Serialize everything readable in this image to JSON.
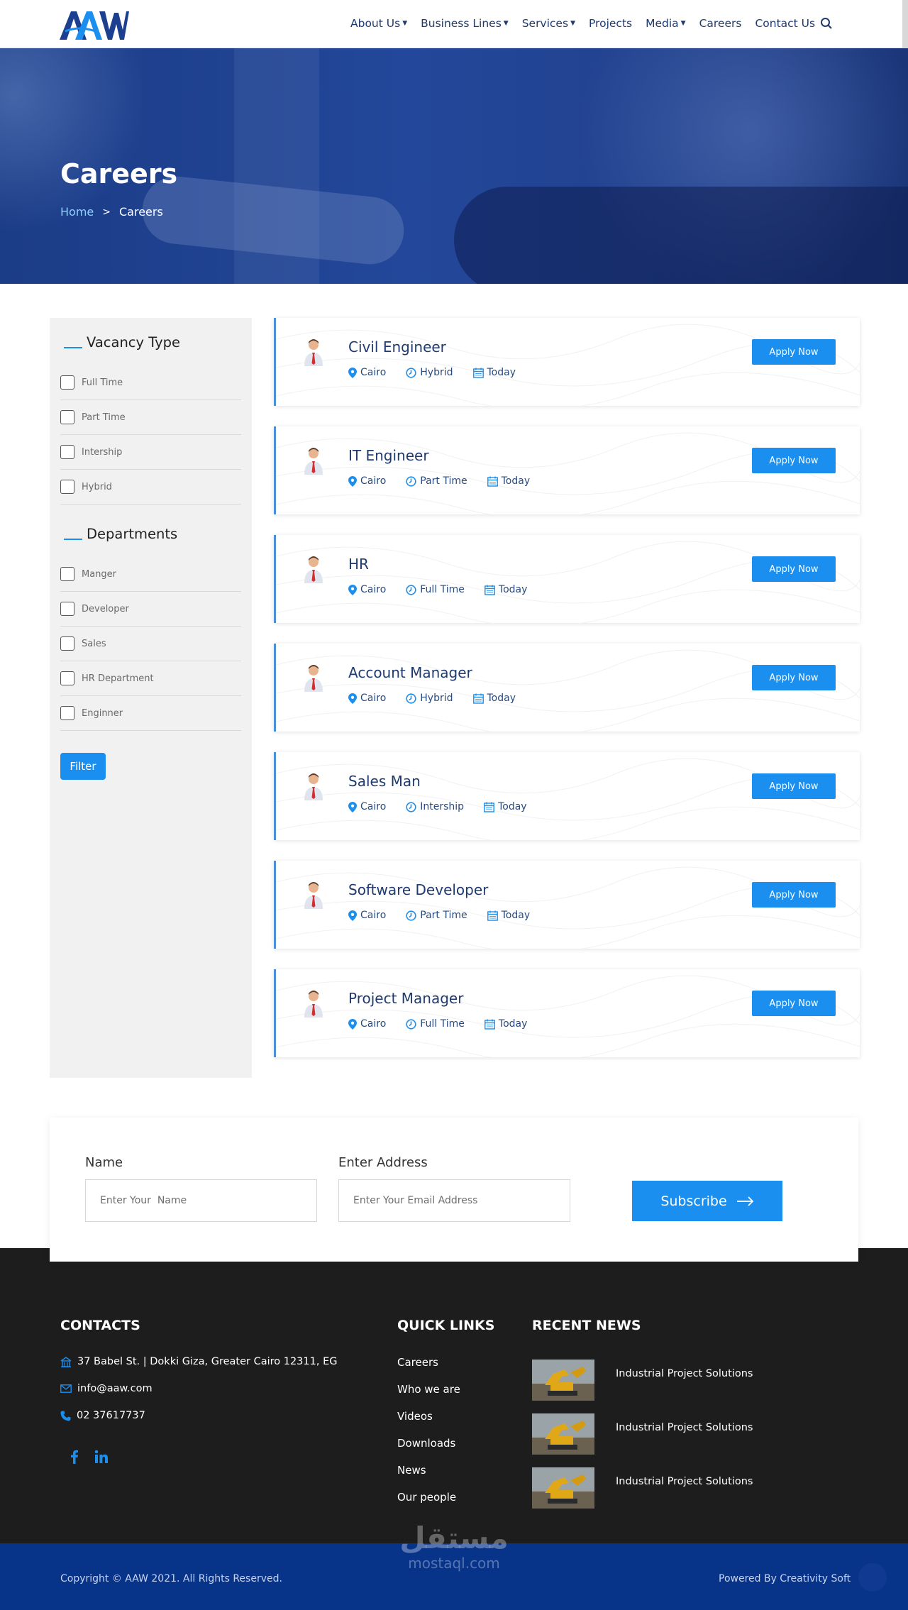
{
  "header": {
    "logo_text": "AAW",
    "nav": [
      {
        "label": "About Us",
        "dropdown": true
      },
      {
        "label": "Business Lines",
        "dropdown": true
      },
      {
        "label": "Services",
        "dropdown": true
      },
      {
        "label": "Projects",
        "dropdown": false
      },
      {
        "label": "Media",
        "dropdown": true
      },
      {
        "label": "Careers",
        "dropdown": false
      },
      {
        "label": "Contact Us",
        "dropdown": false
      }
    ],
    "search_icon": "search-icon"
  },
  "hero": {
    "title": "Careers",
    "breadcrumb": {
      "home": "Home",
      "separator": ">",
      "current": "Careers"
    }
  },
  "sidebar": {
    "vacancy_heading": "Vacancy Type",
    "vacancy_options": [
      "Full Time",
      "Part Time",
      "Intership",
      "Hybrid"
    ],
    "departments_heading": "Departments",
    "department_options": [
      "Manger",
      "Developer",
      "Sales",
      "HR Department",
      "Enginner"
    ],
    "filter_label": "Filter"
  },
  "jobs": [
    {
      "title": "Civil Engineer",
      "location": "Cairo",
      "type": "Hybrid",
      "date": "Today",
      "apply_label": "Apply Now"
    },
    {
      "title": "IT Engineer",
      "location": "Cairo",
      "type": "Part Time",
      "date": "Today",
      "apply_label": "Apply Now"
    },
    {
      "title": "HR",
      "location": "Cairo",
      "type": "Full Time",
      "date": "Today",
      "apply_label": "Apply Now"
    },
    {
      "title": "Account Manager",
      "location": "Cairo",
      "type": "Hybrid",
      "date": "Today",
      "apply_label": "Apply Now"
    },
    {
      "title": "Sales Man",
      "location": "Cairo",
      "type": "Intership",
      "date": "Today",
      "apply_label": "Apply Now"
    },
    {
      "title": "Software Developer",
      "location": "Cairo",
      "type": "Part Time",
      "date": "Today",
      "apply_label": "Apply Now"
    },
    {
      "title": "Project Manager",
      "location": "Cairo",
      "type": "Full Time",
      "date": "Today",
      "apply_label": "Apply Now"
    }
  ],
  "subscribe": {
    "name_label": "Name",
    "name_placeholder": "Enter Your  Name",
    "email_label": "Enter Address",
    "email_placeholder": "Enter Your Email Address",
    "button_label": "Subscribe"
  },
  "footer": {
    "contacts_heading": "CONTACTS",
    "address": "37 Babel St. | Dokki Giza, Greater Cairo 12311, EG",
    "email": "info@aaw.com",
    "phone": "02 37617737",
    "social": [
      "facebook-icon",
      "linkedin-icon"
    ],
    "quick_links_heading": "QUICK LINKS",
    "quick_links": [
      "Careers",
      "Who we are",
      "Videos",
      "Downloads",
      "News",
      "Our people"
    ],
    "recent_news_heading": "RECENT NEWS",
    "recent_news": [
      "Industrial Project Solutions",
      "Industrial Project Solutions",
      "Industrial Project Solutions"
    ],
    "copyright": "Copyright © AAW 2021. All Rights Reserved.",
    "powered_by": "Powered By Creativity Soft",
    "watermark_ar": "مستقل",
    "watermark_en": "mostaql.com"
  },
  "colors": {
    "brand_blue": "#1a8ff0",
    "navy": "#1f3a6e",
    "footer_bg": "#1d1d1d",
    "bottom_bar": "#073389"
  }
}
